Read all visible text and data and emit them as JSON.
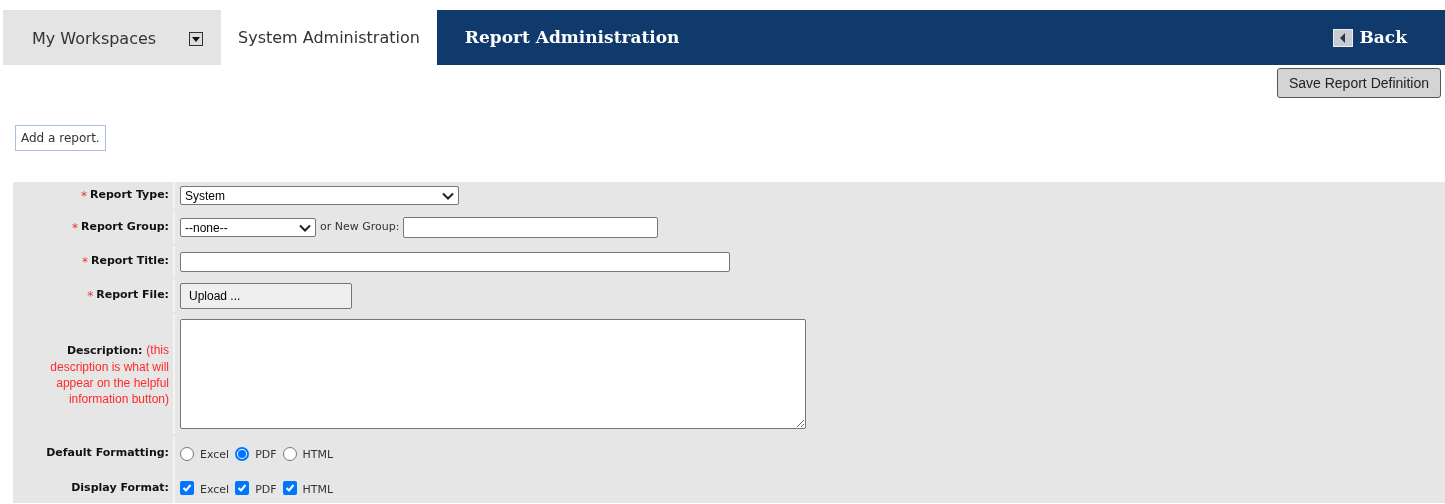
{
  "tabs": [
    {
      "label": "My Workspaces",
      "kind": "dropdown",
      "selected": false
    },
    {
      "label": "System Administration",
      "kind": "plain",
      "selected": true
    }
  ],
  "header": {
    "title": "Report Administration",
    "back": "Back"
  },
  "save_button": "Save Report Definition",
  "instruction": "Add a report.",
  "form": [
    {
      "kind": "select",
      "required_mark": "*",
      "label": "Report Type:",
      "value": "System"
    },
    {
      "kind": "select_group",
      "required_mark": "*",
      "label": "Report Group:",
      "value": "--none--",
      "extra_label": "or New Group:"
    },
    {
      "kind": "text",
      "required_mark": "*",
      "label": "Report Title:"
    },
    {
      "kind": "upload",
      "required_mark": "*",
      "label": "Report File:",
      "button": "Upload ..."
    },
    {
      "kind": "textarea",
      "label": "Description:",
      "note": "(this description is what will appear on the helpful information button)"
    },
    {
      "kind": "radio",
      "label": "Default Formatting:",
      "options": [
        {
          "label": "Excel",
          "selected": false
        },
        {
          "label": "PDF",
          "selected": true
        },
        {
          "label": "HTML",
          "selected": false
        }
      ]
    },
    {
      "kind": "checkbox",
      "label": "Display Format:",
      "options": [
        {
          "label": "Excel",
          "checked": true
        },
        {
          "label": "PDF",
          "checked": true
        },
        {
          "label": "HTML",
          "checked": true
        }
      ]
    }
  ]
}
